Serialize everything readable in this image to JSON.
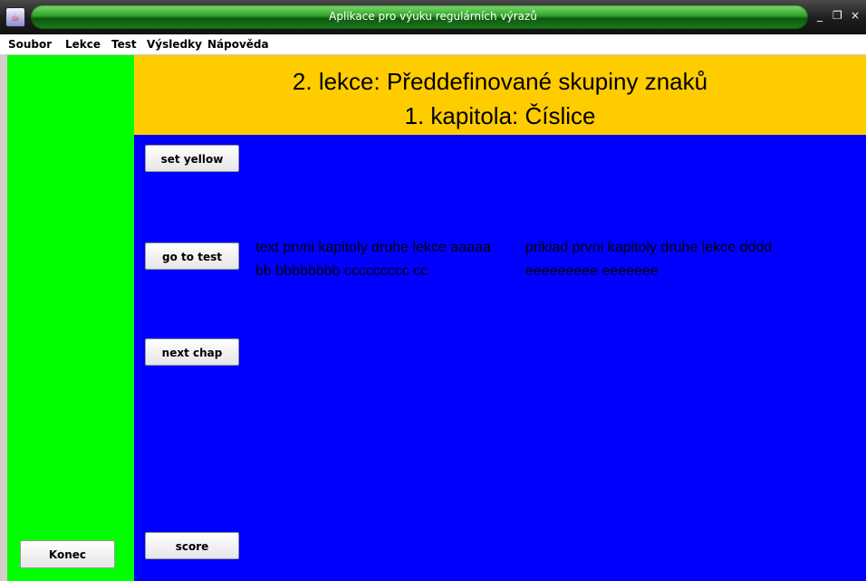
{
  "window": {
    "title": "Aplikace pro výuku regulárních výrazů",
    "minimize_label": "_",
    "maximize_label": "❐",
    "close_label": "×",
    "app_icon": "java-cup-icon"
  },
  "menu": {
    "items": [
      "Soubor",
      "Lekce",
      "Test",
      "Výsledky",
      "Nápověda"
    ]
  },
  "header": {
    "line1": "2. lekce: Předdefinované skupiny znaků",
    "line2": "1. kapitola: Číslice"
  },
  "buttons": {
    "set_yellow": "set yellow",
    "go_to_test": "go to test",
    "next_chap": "next chap",
    "score": "score",
    "konec": "Konec"
  },
  "text": {
    "lesson_text": "text prvni kapitoly druhe lekce aaaaa bb bbbbbbbb ccccccccc cc",
    "example_text": "priklad prvni kapitoly druhe lekce dddd eeeeeeeee eeeeeee"
  },
  "colors": {
    "left_panel": "#00ff00",
    "header_bg": "#ffcc00",
    "main_bg": "#0000ff",
    "titlebar_accent": "#2f9d2a"
  }
}
